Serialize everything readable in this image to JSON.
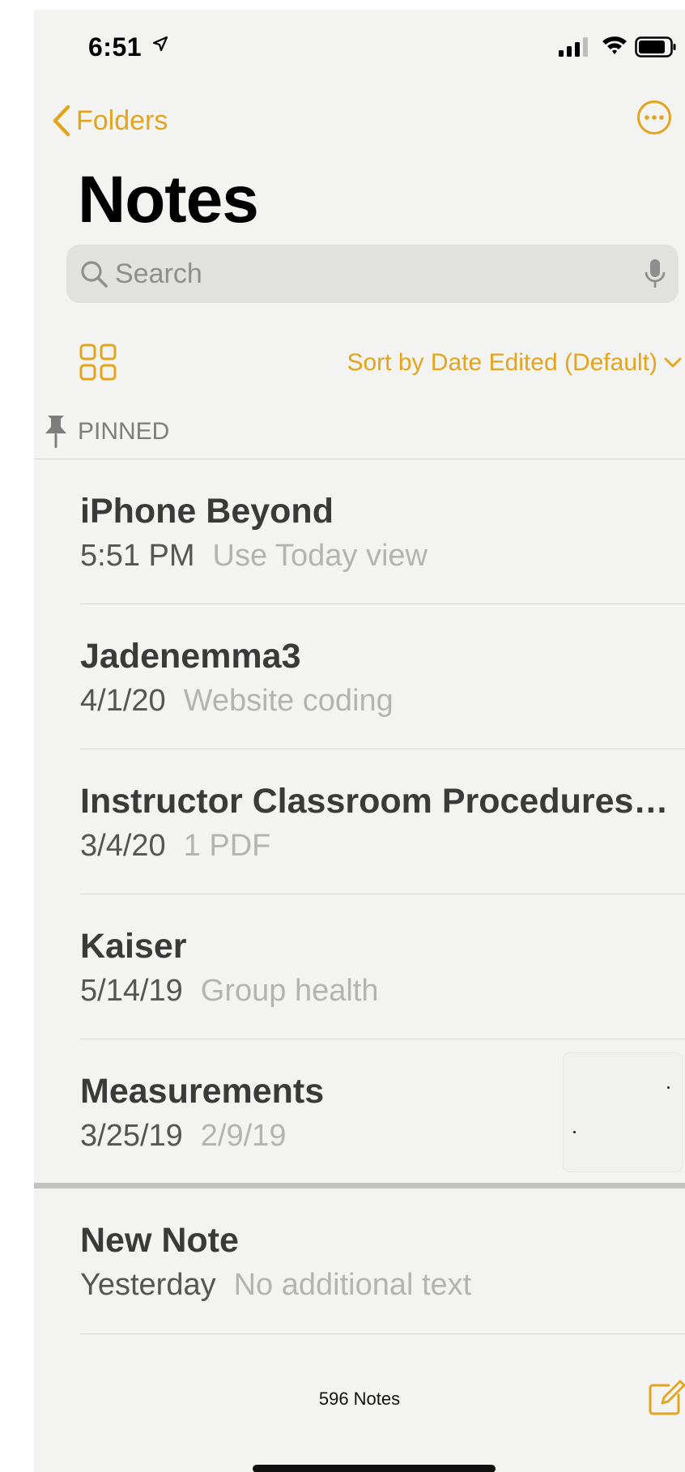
{
  "status_bar": {
    "time": "6:51"
  },
  "nav": {
    "back_label": "Folders"
  },
  "title": "Notes",
  "search": {
    "placeholder": "Search"
  },
  "sort": {
    "label": "Sort by Date Edited (Default)"
  },
  "pinned_section": {
    "label": "PINNED"
  },
  "notes": [
    {
      "title": "iPhone Beyond",
      "date": "5:51 PM",
      "preview": "Use Today view"
    },
    {
      "title": "Jadenemma3",
      "date": "4/1/20",
      "preview": "Website coding"
    },
    {
      "title": "Instructor Classroom Procedures…",
      "date": "3/4/20",
      "preview": "1 PDF"
    },
    {
      "title": "Kaiser",
      "date": "5/14/19",
      "preview": "Group health"
    },
    {
      "title": "Measurements",
      "date": "3/25/19",
      "preview": "2/9/19",
      "has_thumbnail": true
    }
  ],
  "other_notes": [
    {
      "title": "New Note",
      "date": "Yesterday",
      "preview": "No additional text"
    }
  ],
  "toolbar": {
    "count": "596 Notes"
  },
  "colors": {
    "accent": "#e3a51d",
    "background": "#f3f3f1",
    "title": "#3a3a3a",
    "secondary": "#b3b3b3"
  },
  "icons": [
    "location-arrow-icon",
    "cellular-signal-icon",
    "wifi-icon",
    "battery-icon",
    "chevron-left-icon",
    "ellipsis-circle-icon",
    "search-icon",
    "microphone-icon",
    "gallery-grid-icon",
    "chevron-down-icon",
    "pin-icon",
    "compose-icon"
  ]
}
